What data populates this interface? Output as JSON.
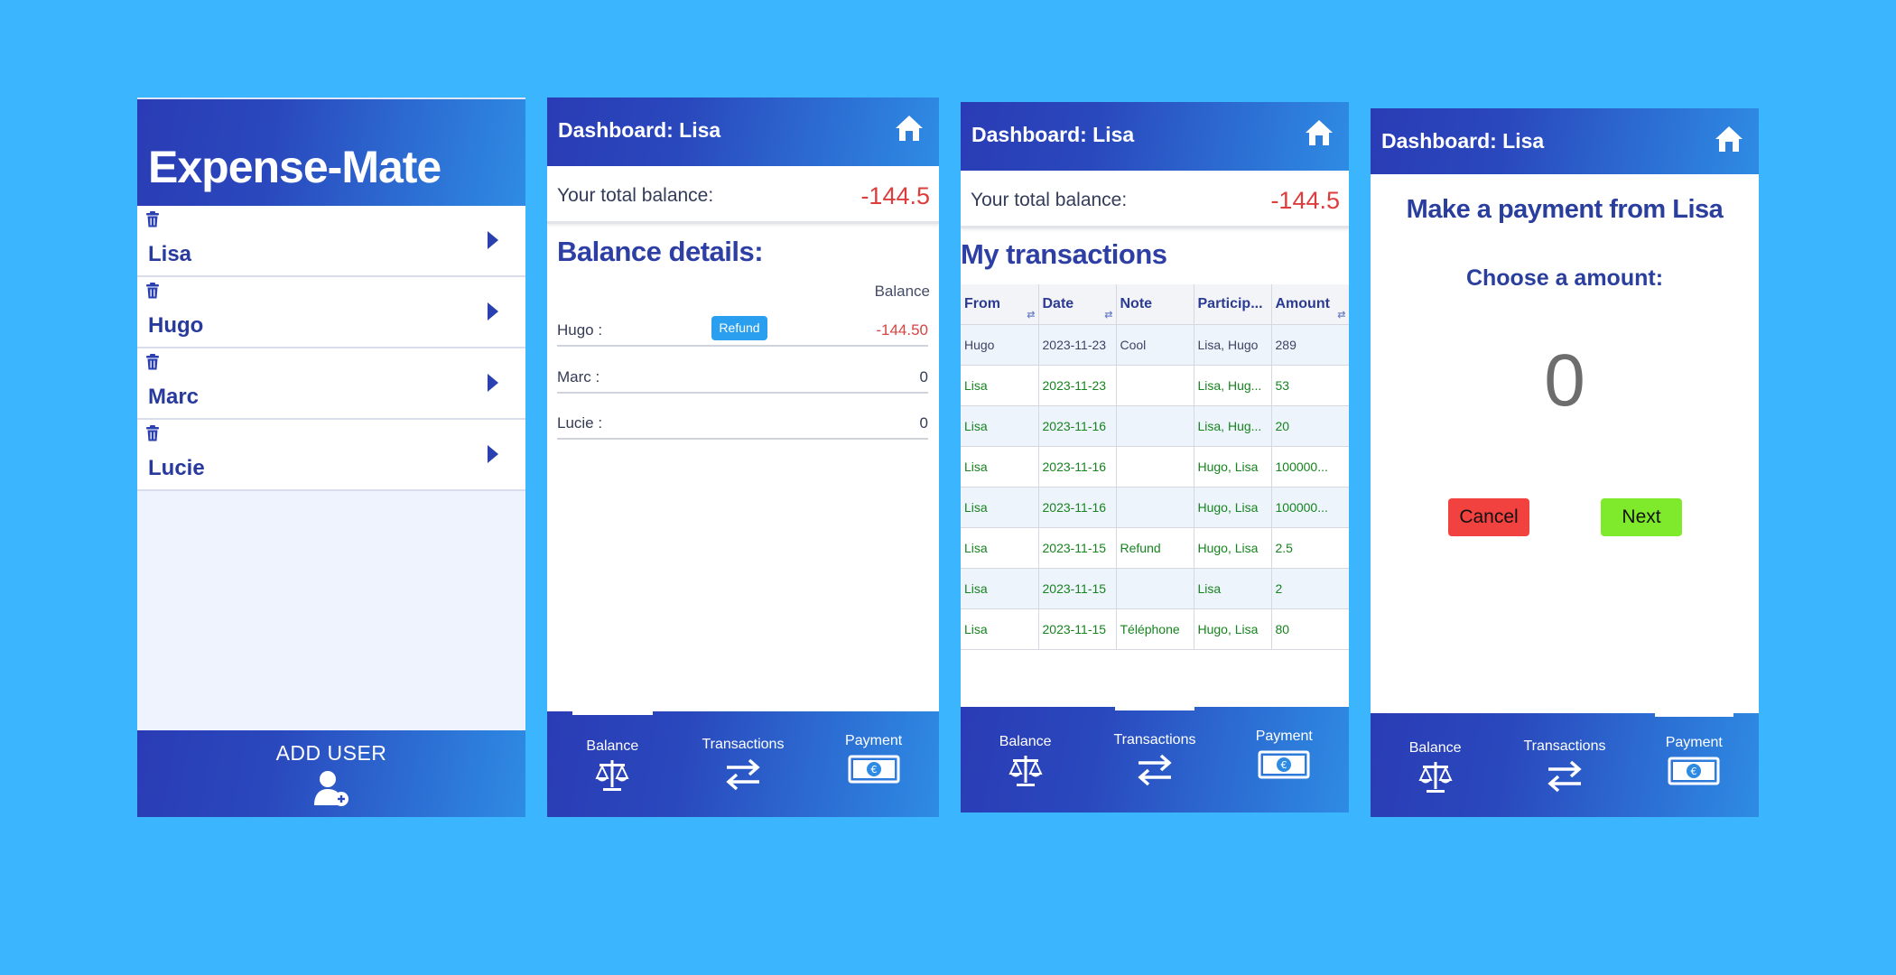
{
  "home": {
    "title": "Expense-Mate",
    "users": [
      {
        "name": "Lisa"
      },
      {
        "name": "Hugo"
      },
      {
        "name": "Marc"
      },
      {
        "name": "Lucie"
      }
    ],
    "add_user_label": "ADD USER"
  },
  "dashboard": {
    "title": "Dashboard: Lisa",
    "total_label": "Your total balance:",
    "total_value": "-144.5"
  },
  "balance": {
    "section_title": "Balance details:",
    "column_header": "Balance",
    "refund_label": "Refund",
    "rows": [
      {
        "name": "Hugo :",
        "amount": "-144.50"
      },
      {
        "name": "Marc :",
        "amount": "0"
      },
      {
        "name": "Lucie :",
        "amount": "0"
      }
    ]
  },
  "transactions": {
    "section_title": "My transactions",
    "columns": [
      "From",
      "Date",
      "Note",
      "Particip...",
      "Amount"
    ],
    "rows": [
      {
        "from": "Hugo",
        "date": "2023-11-23",
        "note": "Cool",
        "participants": "Lisa, Hugo",
        "amount": "289"
      },
      {
        "from": "Lisa",
        "date": "2023-11-23",
        "note": "",
        "participants": "Lisa, Hug...",
        "amount": "53"
      },
      {
        "from": "Lisa",
        "date": "2023-11-16",
        "note": "",
        "participants": "Lisa, Hug...",
        "amount": "20"
      },
      {
        "from": "Lisa",
        "date": "2023-11-16",
        "note": "",
        "participants": "Hugo, Lisa",
        "amount": "100000..."
      },
      {
        "from": "Lisa",
        "date": "2023-11-16",
        "note": "",
        "participants": "Hugo, Lisa",
        "amount": "100000..."
      },
      {
        "from": "Lisa",
        "date": "2023-11-15",
        "note": "Refund",
        "participants": "Hugo, Lisa",
        "amount": "2.5"
      },
      {
        "from": "Lisa",
        "date": "2023-11-15",
        "note": "",
        "participants": "Lisa",
        "amount": "2"
      },
      {
        "from": "Lisa",
        "date": "2023-11-15",
        "note": "Téléphone",
        "participants": "Hugo, Lisa",
        "amount": "80"
      }
    ]
  },
  "payment": {
    "title": "Make a payment from Lisa",
    "subtitle": "Choose a amount:",
    "amount": "0",
    "cancel_label": "Cancel",
    "next_label": "Next"
  },
  "nav": {
    "balance": "Balance",
    "transactions": "Transactions",
    "payment": "Payment"
  },
  "colors": {
    "background": "#3bb5fe",
    "header_gradient_start": "#2a3cb5",
    "header_gradient_end": "#2e8ce4",
    "negative": "#dd3d3d",
    "cancel": "#f1423f",
    "next": "#7fea2c",
    "refund": "#2a9ff0"
  }
}
